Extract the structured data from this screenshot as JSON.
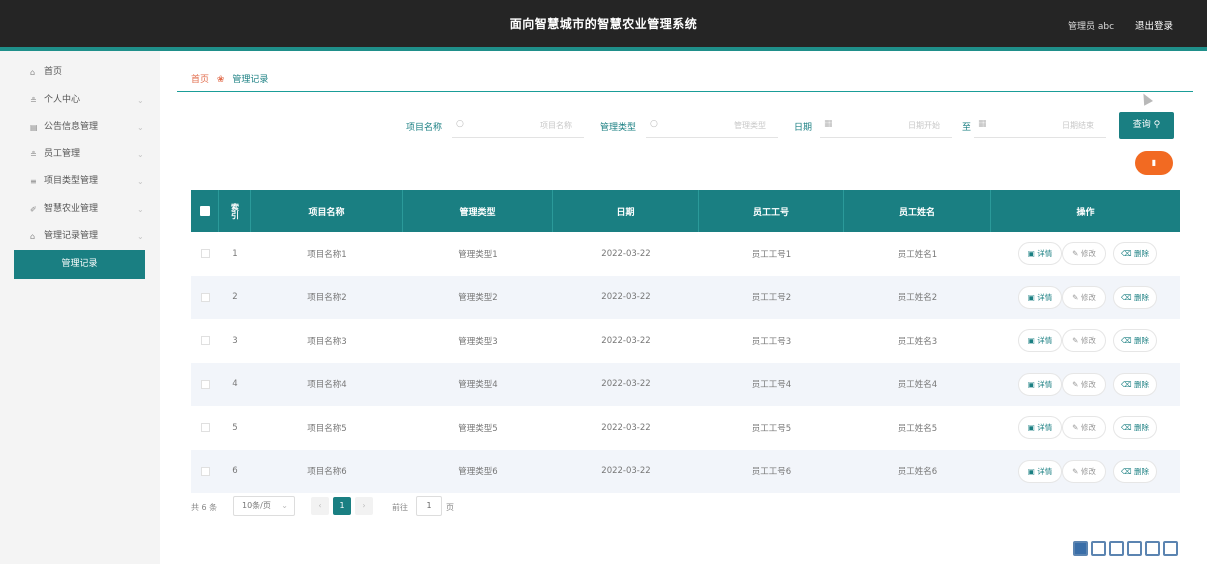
{
  "header": {
    "title": "面向智慧城市的智慧农业管理系统",
    "user": "管理员 abc",
    "logout": "退出登录"
  },
  "sidebar": {
    "items": [
      {
        "label": "首页",
        "icon": "home-icon",
        "glyph": "⌂",
        "arrow": ""
      },
      {
        "label": "个人中心",
        "icon": "user-icon",
        "glyph": "≗",
        "arrow": "⌄"
      },
      {
        "label": "公告信息管理",
        "icon": "notice-icon",
        "glyph": "▤",
        "arrow": "⌄"
      },
      {
        "label": "员工管理",
        "icon": "staff-icon",
        "glyph": "≗",
        "arrow": "⌄"
      },
      {
        "label": "项目类型管理",
        "icon": "category-icon",
        "glyph": "≡",
        "arrow": "⌄"
      },
      {
        "label": "智慧农业管理",
        "icon": "pin-icon",
        "glyph": "✐",
        "arrow": "⌄"
      },
      {
        "label": "管理记录管理",
        "icon": "record-icon",
        "glyph": "⌂",
        "arrow": "⌄"
      }
    ],
    "sub_item": "管理记录"
  },
  "breadcrumb": {
    "home": "首页",
    "separator_icon": "flower-icon",
    "current": "管理记录"
  },
  "filters": {
    "project_label": "项目名称",
    "project_placeholder": "项目名称",
    "type_label": "管理类型",
    "type_placeholder": "管理类型",
    "date_label": "日期",
    "date_start_placeholder": "日期开始",
    "to_label": "至",
    "date_end_placeholder": "日期结束",
    "search_button": "查询",
    "delete_button_icon": "trash-icon"
  },
  "table": {
    "columns": [
      "索引",
      "项目名称",
      "管理类型",
      "日期",
      "员工工号",
      "员工姓名",
      "操作"
    ],
    "rows": [
      {
        "index": "1",
        "project": "项目名称1",
        "type": "管理类型1",
        "date": "2022-03-22",
        "emp_no": "员工工号1",
        "emp_name": "员工姓名1"
      },
      {
        "index": "2",
        "project": "项目名称2",
        "type": "管理类型2",
        "date": "2022-03-22",
        "emp_no": "员工工号2",
        "emp_name": "员工姓名2"
      },
      {
        "index": "3",
        "project": "项目名称3",
        "type": "管理类型3",
        "date": "2022-03-22",
        "emp_no": "员工工号3",
        "emp_name": "员工姓名3"
      },
      {
        "index": "4",
        "project": "项目名称4",
        "type": "管理类型4",
        "date": "2022-03-22",
        "emp_no": "员工工号4",
        "emp_name": "员工姓名4"
      },
      {
        "index": "5",
        "project": "项目名称5",
        "type": "管理类型5",
        "date": "2022-03-22",
        "emp_no": "员工工号5",
        "emp_name": "员工姓名5"
      },
      {
        "index": "6",
        "project": "项目名称6",
        "type": "管理类型6",
        "date": "2022-03-22",
        "emp_no": "员工工号6",
        "emp_name": "员工姓名6"
      }
    ],
    "actions": {
      "detail": "详情",
      "edit": "修改",
      "delete": "删除"
    }
  },
  "pagination": {
    "total_text": "共 6 条",
    "page_size": "10条/页",
    "current_page": "1",
    "goto_label": "前往",
    "goto_value": "1",
    "page_suffix": "页"
  },
  "colors": {
    "primary": "#1a7f82",
    "header_bg": "#252525",
    "delete_button": "#f26a22",
    "breadcrumb_home": "#e26c4c"
  }
}
